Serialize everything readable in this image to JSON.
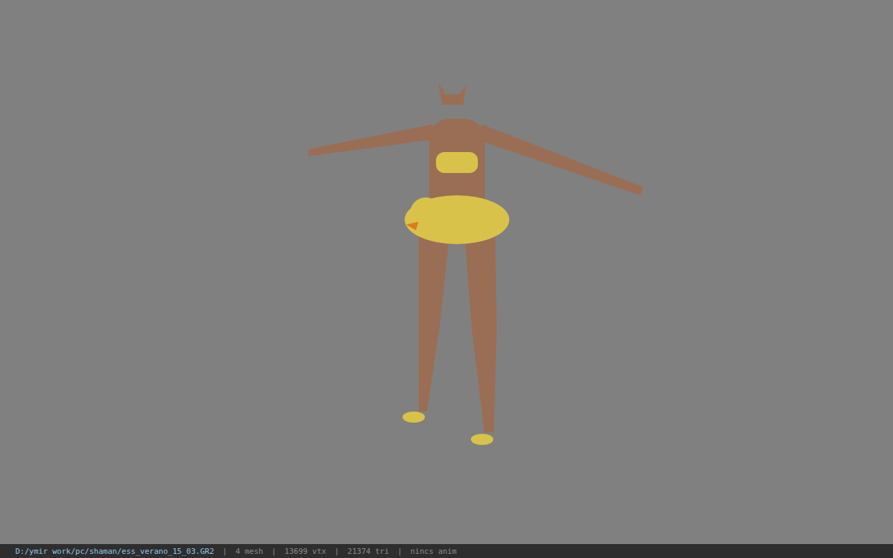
{
  "status_bar": {
    "file": "D:/ymir work/pc/shaman/ess_verano_15_03.GR2",
    "separator": "|",
    "stats": [
      "4 mesh",
      "13699 vtx",
      "21374 tri",
      "nincs anim"
    ]
  }
}
